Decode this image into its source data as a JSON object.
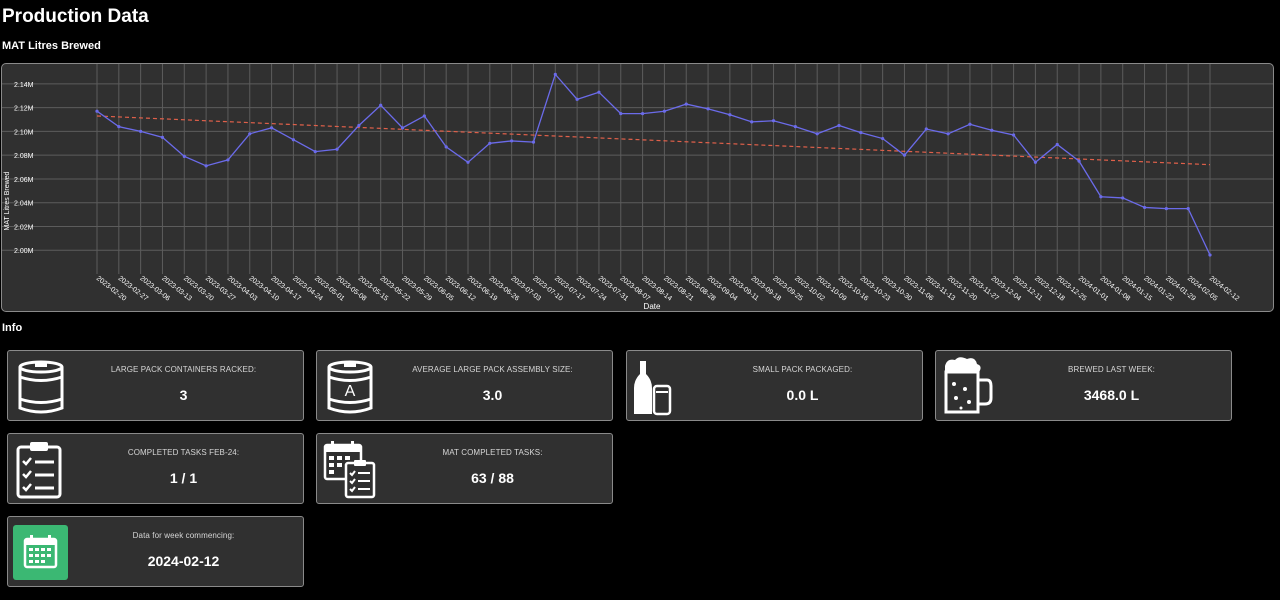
{
  "page": {
    "title": "Production Data"
  },
  "chart_section": {
    "title": "MAT Litres Brewed"
  },
  "chart_data": {
    "type": "line",
    "title": "",
    "xlabel": "Date",
    "ylabel": "MAT Litres Brewed",
    "ylim": [
      1.98,
      2.15
    ],
    "yticks": [
      2.0,
      2.02,
      2.04,
      2.06,
      2.08,
      2.1,
      2.12,
      2.14
    ],
    "ytick_labels": [
      "2.00M",
      "2.02M",
      "2.04M",
      "2.06M",
      "2.08M",
      "2.10M",
      "2.12M",
      "2.14M"
    ],
    "grid": true,
    "x": [
      "2023-02-20",
      "2023-02-27",
      "2023-03-06",
      "2023-03-13",
      "2023-03-20",
      "2023-03-27",
      "2023-04-03",
      "2023-04-10",
      "2023-04-17",
      "2023-04-24",
      "2023-05-01",
      "2023-05-08",
      "2023-05-15",
      "2023-05-22",
      "2023-05-29",
      "2023-06-05",
      "2023-06-12",
      "2023-06-19",
      "2023-06-26",
      "2023-07-03",
      "2023-07-10",
      "2023-07-17",
      "2023-07-24",
      "2023-07-31",
      "2023-08-07",
      "2023-08-14",
      "2023-08-21",
      "2023-08-28",
      "2023-09-04",
      "2023-09-11",
      "2023-09-18",
      "2023-09-25",
      "2023-10-02",
      "2023-10-09",
      "2023-10-16",
      "2023-10-23",
      "2023-10-30",
      "2023-11-06",
      "2023-11-13",
      "2023-11-20",
      "2023-11-27",
      "2023-12-04",
      "2023-12-11",
      "2023-12-18",
      "2023-12-25",
      "2024-01-01",
      "2024-01-08",
      "2024-01-15",
      "2024-01-22",
      "2024-01-29",
      "2024-02-05",
      "2024-02-12"
    ],
    "series": [
      {
        "color": "#6b6bea",
        "values": [
          2.117,
          2.104,
          2.1,
          2.095,
          2.079,
          2.071,
          2.076,
          2.098,
          2.103,
          2.093,
          2.083,
          2.085,
          2.105,
          2.122,
          2.103,
          2.113,
          2.087,
          2.074,
          2.09,
          2.092,
          2.091,
          2.148,
          2.127,
          2.133,
          2.115,
          2.115,
          2.117,
          2.123,
          2.119,
          2.114,
          2.108,
          2.109,
          2.104,
          2.098,
          2.105,
          2.099,
          2.094,
          2.08,
          2.102,
          2.098,
          2.106,
          2.101,
          2.097,
          2.074,
          2.089,
          2.075,
          2.045,
          2.044,
          2.036,
          2.035,
          2.035,
          1.996
        ]
      },
      {
        "color": "#e0604a",
        "dashed": true,
        "values": [
          2.113,
          2.072
        ]
      }
    ]
  },
  "info_section": {
    "title": "Info"
  },
  "cards": [
    {
      "label": "LARGE PACK CONTAINERS RACKED:",
      "value": "3",
      "icon": "keg-icon"
    },
    {
      "label": "AVERAGE LARGE PACK ASSEMBLY SIZE:",
      "value": "3.0",
      "icon": "keg-a-icon",
      "icon_letter": "A"
    },
    {
      "label": "SMALL PACK PACKAGED:",
      "value": "0.0 L",
      "icon": "bottle-can-icon"
    },
    {
      "label": "BREWED LAST WEEK:",
      "value": "3468.0 L",
      "icon": "beer-mug-icon"
    },
    {
      "label": "COMPLETED TASKS FEB-24:",
      "value": "1 / 1",
      "icon": "clipboard-checklist-icon"
    },
    {
      "label": "MAT COMPLETED TASKS:",
      "value": "63 / 88",
      "icon": "calendar-checklist-icon"
    },
    {
      "label": "Data for week commencing:",
      "value": "2024-02-12",
      "icon": "calendar-icon",
      "icon_color": "#3bb873"
    }
  ]
}
